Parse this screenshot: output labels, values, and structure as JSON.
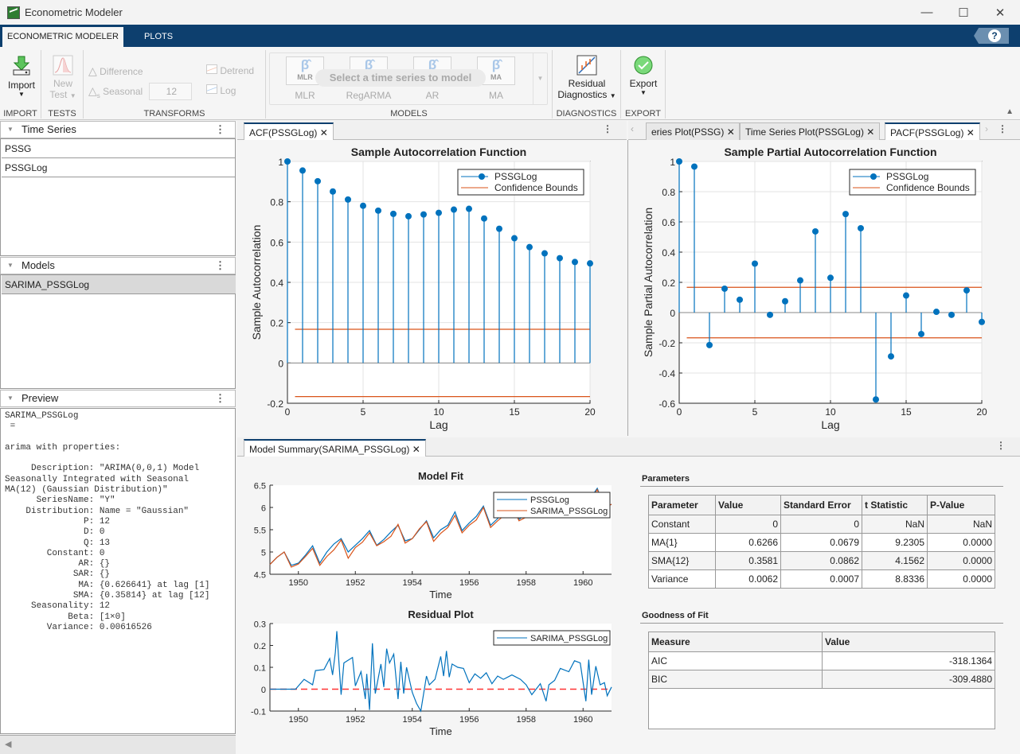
{
  "window": {
    "title": "Econometric Modeler",
    "minimize": "—",
    "maximize": "☐",
    "close": "✕"
  },
  "ribbon": {
    "tabs": [
      {
        "label": "ECONOMETRIC MODELER",
        "active": true
      },
      {
        "label": "PLOTS",
        "active": false
      }
    ],
    "help": "?",
    "import": {
      "label": "Import",
      "section": "IMPORT"
    },
    "tests": {
      "label1": "New",
      "label2": "Test",
      "section": "TESTS"
    },
    "transforms": {
      "difference": "Difference",
      "seasonal": "Seasonal",
      "seasonal_value": "12",
      "detrend": "Detrend",
      "log": "Log",
      "section": "TRANSFORMS"
    },
    "models": {
      "items": [
        {
          "glyph": "β̂",
          "sub": "MLR",
          "label": "MLR"
        },
        {
          "glyph": "β̂",
          "sub": "",
          "label": "RegARMA"
        },
        {
          "glyph": "β̂",
          "sub": "",
          "label": "AR"
        },
        {
          "glyph": "β̂",
          "sub": "MA",
          "label": "MA"
        }
      ],
      "hint": "Select a time series to model",
      "section": "MODELS"
    },
    "diagnostics": {
      "label1": "Residual",
      "label2": "Diagnostics",
      "section": "DIAGNOSTICS"
    },
    "export": {
      "label": "Export",
      "section": "EXPORT"
    }
  },
  "left": {
    "time_series": {
      "title": "Time Series",
      "items": [
        "PSSG",
        "PSSGLog"
      ]
    },
    "models": {
      "title": "Models",
      "items": [
        "SARIMA_PSSGLog"
      ]
    },
    "preview": {
      "title": "Preview",
      "text": "SARIMA_PSSGLog\n =\n\narima with properties:\n\n     Description: \"ARIMA(0,0,1) Model\nSeasonally Integrated with Seasonal\nMA(12) (Gaussian Distribution)\"\n      SeriesName: \"Y\"\n    Distribution: Name = \"Gaussian\"\n               P: 12\n               D: 0\n               Q: 13\n        Constant: 0\n              AR: {}\n             SAR: {}\n              MA: {0.626641} at lag [1]\n             SMA: {0.35814} at lag [12]\n     Seasonality: 12\n            Beta: [1×0]\n        Variance: 0.00616526"
    }
  },
  "doc_tabs": {
    "left": [
      {
        "label": "ACF(PSSGLog) ✕",
        "active": true
      }
    ],
    "right": [
      {
        "label": "eries Plot(PSSG) ✕",
        "active": false
      },
      {
        "label": "Time Series Plot(PSSGLog) ✕",
        "active": false
      },
      {
        "label": "PACF(PSSGLog) ✕",
        "active": true
      }
    ],
    "bottom": [
      {
        "label": "Model Summary(SARIMA_PSSGLog) ✕",
        "active": true
      }
    ]
  },
  "chart_data": [
    {
      "type": "stem",
      "title": "Sample Autocorrelation Function",
      "xlabel": "Lag",
      "ylabel": "Sample Autocorrelation",
      "xlim": [
        0,
        20
      ],
      "ylim": [
        -0.2,
        1
      ],
      "xticks": [
        0,
        5,
        10,
        15,
        20
      ],
      "yticks": [
        -0.2,
        0,
        0.2,
        0.4,
        0.6,
        0.8,
        1
      ],
      "legend": [
        "PSSGLog",
        "Confidence Bounds"
      ],
      "legend_position": "top-right",
      "x": [
        0,
        1,
        2,
        3,
        4,
        5,
        6,
        7,
        8,
        9,
        10,
        11,
        12,
        13,
        14,
        15,
        16,
        17,
        18,
        19,
        20
      ],
      "values": [
        1.0,
        0.955,
        0.902,
        0.851,
        0.811,
        0.78,
        0.756,
        0.74,
        0.728,
        0.737,
        0.745,
        0.761,
        0.765,
        0.717,
        0.666,
        0.619,
        0.575,
        0.544,
        0.52,
        0.501,
        0.494
      ],
      "confidence_bounds": [
        0.167,
        -0.167
      ],
      "colors": {
        "series": "#0072bd",
        "bounds": "#d95319"
      }
    },
    {
      "type": "stem",
      "title": "Sample Partial Autocorrelation Function",
      "xlabel": "Lag",
      "ylabel": "Sample Partial Autocorrelation",
      "xlim": [
        0,
        20
      ],
      "ylim": [
        -0.6,
        1
      ],
      "xticks": [
        0,
        5,
        10,
        15,
        20
      ],
      "yticks": [
        -0.6,
        -0.4,
        -0.2,
        0,
        0.2,
        0.4,
        0.6,
        0.8,
        1
      ],
      "legend": [
        "PSSGLog",
        "Confidence Bounds"
      ],
      "legend_position": "top-right",
      "x": [
        0,
        1,
        2,
        3,
        4,
        5,
        6,
        7,
        8,
        9,
        10,
        11,
        12,
        13,
        14,
        15,
        16,
        17,
        18,
        19,
        20
      ],
      "values": [
        1.0,
        0.966,
        -0.215,
        0.158,
        0.085,
        0.324,
        -0.015,
        0.075,
        0.213,
        0.537,
        0.23,
        0.652,
        0.558,
        -0.575,
        -0.29,
        0.113,
        -0.142,
        0.005,
        -0.015,
        0.147,
        -0.062
      ],
      "confidence_bounds": [
        0.167,
        -0.167
      ],
      "colors": {
        "series": "#0072bd",
        "bounds": "#d95319"
      }
    },
    {
      "type": "line",
      "title": "Model Fit",
      "xlabel": "Time",
      "ylabel": "",
      "xlim": [
        1949,
        1961
      ],
      "ylim": [
        4.5,
        6.5
      ],
      "xticks": [
        1950,
        1952,
        1954,
        1956,
        1958,
        1960
      ],
      "yticks": [
        4.5,
        5,
        5.5,
        6,
        6.5
      ],
      "legend_position": "top-right",
      "series": [
        {
          "name": "PSSGLog",
          "color": "#0072bd",
          "x": [
            1949.0,
            1949.25,
            1949.5,
            1949.75,
            1950.0,
            1950.25,
            1950.5,
            1950.75,
            1951.0,
            1951.25,
            1951.5,
            1951.75,
            1952.0,
            1952.25,
            1952.5,
            1952.75,
            1953.0,
            1953.25,
            1953.5,
            1953.75,
            1954.0,
            1954.25,
            1954.5,
            1954.75,
            1955.0,
            1955.25,
            1955.5,
            1955.75,
            1956.0,
            1956.25,
            1956.5,
            1956.75,
            1957.0,
            1957.25,
            1957.5,
            1957.75,
            1958.0,
            1958.25,
            1958.5,
            1958.75,
            1959.0,
            1959.25,
            1959.5,
            1959.75,
            1960.0,
            1960.25,
            1960.5,
            1960.75,
            1961.0
          ],
          "values": [
            4.72,
            4.88,
            5.0,
            4.7,
            4.75,
            4.93,
            5.14,
            4.75,
            5.0,
            5.18,
            5.3,
            5.0,
            5.15,
            5.3,
            5.48,
            5.15,
            5.28,
            5.45,
            5.6,
            5.25,
            5.3,
            5.5,
            5.7,
            5.32,
            5.5,
            5.6,
            5.9,
            5.48,
            5.65,
            5.8,
            6.03,
            5.6,
            5.75,
            5.9,
            6.1,
            5.73,
            5.85,
            6.0,
            6.2,
            5.78,
            5.95,
            6.1,
            6.3,
            5.97,
            6.05,
            6.2,
            6.43,
            6.0,
            6.07
          ]
        },
        {
          "name": "SARIMA_PSSGLog",
          "color": "#d95319",
          "x": [
            1949.0,
            1949.25,
            1949.5,
            1949.75,
            1950.0,
            1950.25,
            1950.5,
            1950.75,
            1951.0,
            1951.25,
            1951.5,
            1951.75,
            1952.0,
            1952.25,
            1952.5,
            1952.75,
            1953.0,
            1953.25,
            1953.5,
            1953.75,
            1954.0,
            1954.25,
            1954.5,
            1954.75,
            1955.0,
            1955.25,
            1955.5,
            1955.75,
            1956.0,
            1956.25,
            1956.5,
            1956.75,
            1957.0,
            1957.25,
            1957.5,
            1957.75,
            1958.0,
            1958.25,
            1958.5,
            1958.75,
            1959.0,
            1959.25,
            1959.5,
            1959.75,
            1960.0,
            1960.25,
            1960.5,
            1960.75,
            1961.0
          ],
          "values": [
            4.72,
            4.88,
            5.0,
            4.66,
            4.73,
            4.9,
            5.08,
            4.7,
            4.9,
            5.05,
            5.27,
            4.86,
            5.1,
            5.22,
            5.43,
            5.14,
            5.23,
            5.35,
            5.62,
            5.2,
            5.3,
            5.52,
            5.68,
            5.24,
            5.42,
            5.55,
            5.82,
            5.43,
            5.6,
            5.72,
            6.0,
            5.55,
            5.7,
            5.83,
            6.05,
            5.7,
            5.78,
            5.93,
            6.15,
            5.78,
            5.85,
            6.0,
            6.25,
            5.78,
            6.0,
            6.15,
            6.4,
            6.0,
            6.07
          ]
        }
      ]
    },
    {
      "type": "line",
      "title": "Residual Plot",
      "xlabel": "Time",
      "ylabel": "",
      "xlim": [
        1949,
        1961
      ],
      "ylim": [
        -0.1,
        0.3
      ],
      "xticks": [
        1950,
        1952,
        1954,
        1956,
        1958,
        1960
      ],
      "yticks": [
        -0.1,
        0,
        0.1,
        0.2,
        0.3
      ],
      "legend_position": "top-right",
      "zero_line_color": "#ff3333",
      "series": [
        {
          "name": "SARIMA_PSSGLog",
          "color": "#0072bd",
          "x": [
            1949.0,
            1949.9,
            1950.2,
            1950.5,
            1950.6,
            1950.9,
            1951.1,
            1951.2,
            1951.3,
            1951.35,
            1951.5,
            1951.6,
            1951.9,
            1952.0,
            1952.2,
            1952.35,
            1952.4,
            1952.5,
            1952.6,
            1952.7,
            1952.9,
            1953.0,
            1953.1,
            1953.2,
            1953.35,
            1953.5,
            1953.6,
            1953.7,
            1953.8,
            1954.0,
            1954.15,
            1954.3,
            1954.5,
            1954.6,
            1954.8,
            1955.0,
            1955.1,
            1955.2,
            1955.3,
            1955.4,
            1955.6,
            1955.8,
            1956.0,
            1956.2,
            1956.4,
            1956.6,
            1956.8,
            1957.0,
            1957.2,
            1957.5,
            1957.8,
            1958.0,
            1958.2,
            1958.5,
            1958.7,
            1958.8,
            1959.0,
            1959.2,
            1959.5,
            1959.7,
            1959.9,
            1960.1,
            1960.2,
            1960.3,
            1960.45,
            1960.6,
            1960.75,
            1960.85,
            1961.0
          ],
          "values": [
            0,
            0,
            0.045,
            0.02,
            0.085,
            0.09,
            0.14,
            0.065,
            0.17,
            0.265,
            -0.025,
            0.12,
            0.145,
            0.015,
            0.08,
            -0.045,
            0.07,
            -0.095,
            0.21,
            -0.02,
            0.115,
            0.01,
            0.185,
            0.12,
            0.16,
            -0.045,
            0.125,
            -0.02,
            0.1,
            -0.015,
            -0.065,
            -0.1,
            0.06,
            0.02,
            0.045,
            0.15,
            0.06,
            0.175,
            0.055,
            0.115,
            0.1,
            0.095,
            0.03,
            0.07,
            0.05,
            0.075,
            0.025,
            0.06,
            0.045,
            0.065,
            0.045,
            0.02,
            -0.025,
            0.025,
            -0.055,
            0.02,
            0.04,
            0.095,
            0.08,
            0.13,
            0.12,
            -0.055,
            0.135,
            -0.025,
            0.105,
            0.02,
            0.03,
            -0.03,
            0.01
          ]
        }
      ]
    }
  ],
  "summary": {
    "parameters": {
      "title": "Parameters",
      "headers": [
        "Parameter",
        "Value",
        "Standard Error",
        "t Statistic",
        "P-Value"
      ],
      "rows": [
        [
          "Constant",
          "0",
          "0",
          "NaN",
          "NaN"
        ],
        [
          "MA{1}",
          "0.6266",
          "0.0679",
          "9.2305",
          "0.0000"
        ],
        [
          "SMA{12}",
          "0.3581",
          "0.0862",
          "4.1562",
          "0.0000"
        ],
        [
          "Variance",
          "0.0062",
          "0.0007",
          "8.8336",
          "0.0000"
        ]
      ]
    },
    "gof": {
      "title": "Goodness of Fit",
      "headers": [
        "Measure",
        "Value"
      ],
      "rows": [
        [
          "AIC",
          "-318.1364"
        ],
        [
          "BIC",
          "-309.4880"
        ]
      ]
    }
  }
}
